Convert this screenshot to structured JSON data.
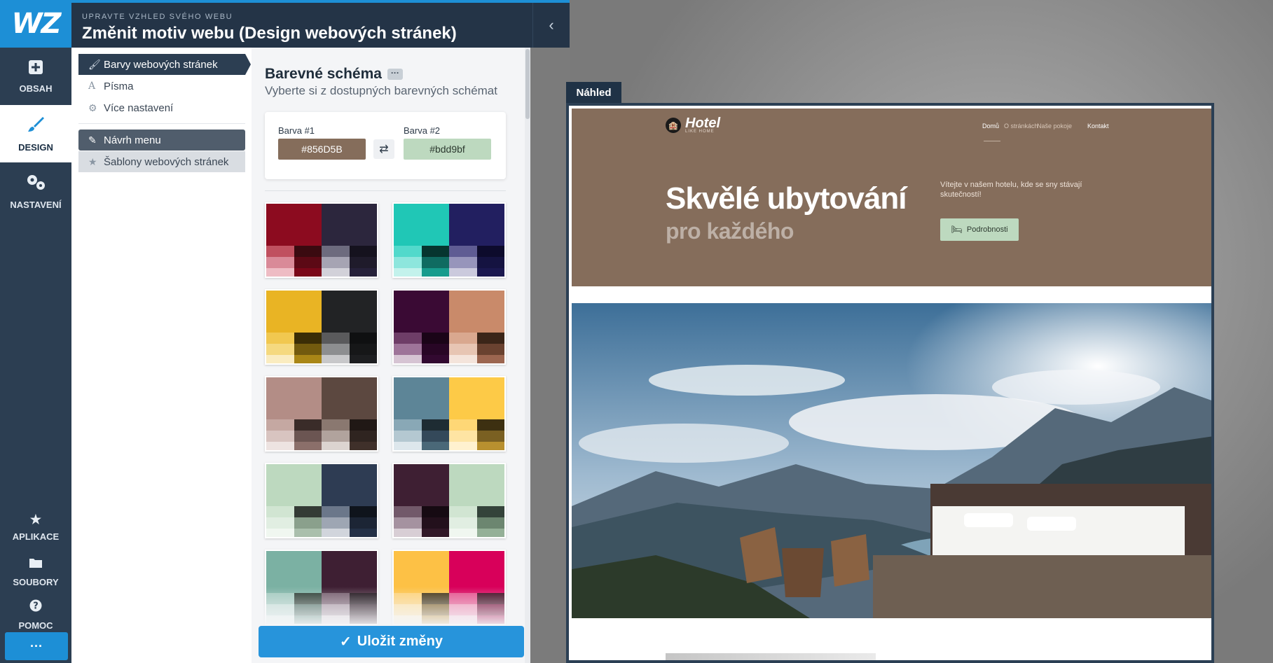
{
  "brand": {
    "logo_text": "WZ"
  },
  "header": {
    "subtitle": "UPRAVTE VZHLED SVÉHO WEBU",
    "title": "Změnit motiv webu (Design webových stránek)",
    "collapse_glyph": "‹"
  },
  "rail": {
    "items": [
      {
        "label": "OBSAH",
        "icon": "plus-square-icon"
      },
      {
        "label": "DESIGN",
        "icon": "paintbrush-icon",
        "active": true
      },
      {
        "label": "NASTAVENÍ",
        "icon": "gears-icon"
      },
      {
        "label": "APLIKACE",
        "icon": "star-icon"
      },
      {
        "label": "SOUBORY",
        "icon": "folder-icon"
      },
      {
        "label": "POMOC",
        "icon": "help-icon"
      }
    ],
    "more": "···"
  },
  "submenu": {
    "items": [
      {
        "label": "Barvy webových stránek",
        "icon": "paintbrush-icon"
      },
      {
        "label": "Písma",
        "icon": "font-icon"
      },
      {
        "label": "Více nastavení",
        "icon": "gears-icon"
      },
      {
        "label": "Návrh menu",
        "icon": "pencil-icon"
      },
      {
        "label": "Šablony webových stránek",
        "icon": "star-icon"
      }
    ]
  },
  "panel": {
    "title": "Barevné schéma",
    "dots": "···",
    "subtitle": "Vyberte si z dostupných barevných schémat",
    "color1_label": "Barva #1",
    "color1_value": "#856D5B",
    "color2_label": "Barva #2",
    "color2_value": "#bdd9bf",
    "swap_glyph": "⇄",
    "save_label": "Uložit změny",
    "palettes": [
      {
        "a": "#8c0b1f",
        "b": "#2c263d",
        "sa": [
          "#c0505f",
          "#3a0a10",
          "#d98a98",
          "#5c0915",
          "#eebcc4",
          "#7a0718"
        ],
        "sb": [
          "#6d6b7e",
          "#15121e",
          "#a6a4b3",
          "#1f1b2b",
          "#d2d1d9",
          "#26213a"
        ]
      },
      {
        "a": "#20c7b6",
        "b": "#221f60",
        "sa": [
          "#52d9cb",
          "#06352f",
          "#8ee6dd",
          "#0f6b61",
          "#c3f2ec",
          "#179c8d"
        ],
        "sb": [
          "#5f5c93",
          "#0d0b2c",
          "#9795bb",
          "#151341",
          "#cbcadd",
          "#1b184f"
        ]
      },
      {
        "a": "#e9b424",
        "b": "#222325",
        "sa": [
          "#f1c850",
          "#3a2d06",
          "#f5d97f",
          "#725a0e",
          "#faecc0",
          "#a98616"
        ],
        "sb": [
          "#5a5a5c",
          "#0f1011",
          "#8d8e90",
          "#161718",
          "#c8c8ca",
          "#1d1e20"
        ]
      },
      {
        "a": "#3a0a34",
        "b": "#c98a6a",
        "sa": [
          "#6e3d67",
          "#1a0417",
          "#9e7499",
          "#280625",
          "#d6c4d3",
          "#320930"
        ],
        "sb": [
          "#d9a88f",
          "#3b2518",
          "#e7c5b3",
          "#6a4230",
          "#f4e4db",
          "#9c6650"
        ]
      },
      {
        "a": "#b38d86",
        "b": "#5c4840",
        "sa": [
          "#c5a8a2",
          "#3a2c29",
          "#d8c4c0",
          "#6b5552",
          "#ede3e1",
          "#8b6f6a"
        ],
        "sb": [
          "#8a7870",
          "#201815",
          "#b1a39d",
          "#2f2420",
          "#dcd4d0",
          "#3f302a"
        ]
      },
      {
        "a": "#5d8597",
        "b": "#fdca47",
        "sa": [
          "#89a8b6",
          "#1e2c33",
          "#b4c8d1",
          "#34495a",
          "#dde7ec",
          "#4a6878"
        ],
        "sb": [
          "#fed776",
          "#3d3011",
          "#fee4a3",
          "#7a6022",
          "#fff1cf",
          "#b8902f"
        ]
      },
      {
        "a": "#bdd9bf",
        "b": "#2e3c53",
        "sa": [
          "#d1e5d2",
          "#343b35",
          "#e1eee2",
          "#8aa08c",
          "#f0f7f0",
          "#aabfac"
        ],
        "sb": [
          "#6b778a",
          "#0f141c",
          "#9ea6b3",
          "#1c2535",
          "#d1d5dc",
          "#243046"
        ]
      },
      {
        "a": "#3e1f33",
        "b": "#bdd9bf",
        "sa": [
          "#72596a",
          "#160a12",
          "#a592a0",
          "#23101c",
          "#d8ced5",
          "#311827"
        ],
        "sb": [
          "#d1e5d2",
          "#34433a",
          "#e1eee2",
          "#6c8670",
          "#f0f7f0",
          "#94b097"
        ]
      },
      {
        "a": "#7bb1a3",
        "b": "#3e1f33",
        "sa": [
          "#a0c8bd",
          "#26382f",
          "#c2dcd5",
          "#4b6c62",
          "#e2efeb",
          "#5e8b7e"
        ],
        "sb": [
          "#72596a",
          "#160a12",
          "#a592a0",
          "#23101c",
          "#d8ced5",
          "#311827"
        ]
      },
      {
        "a": "#fdc145",
        "b": "#d8005a",
        "sa": [
          "#fed176",
          "#3d2e10",
          "#fee1a3",
          "#7a5b1f",
          "#fff0d1",
          "#b98a2e"
        ],
        "sb": [
          "#e44d8a",
          "#3a0018",
          "#ee8cb3",
          "#70002f",
          "#f7c6da",
          "#a30045"
        ]
      }
    ]
  },
  "preview": {
    "tab_label": "Náhled",
    "site": {
      "logo_mark": "🏨",
      "logo_name": "Hotel",
      "logo_tag": "LIKE HOME",
      "nav": [
        "Domů",
        "O stránkách",
        "Naše pokoje",
        "Kontakt"
      ],
      "headline": "Skvělé ubytování",
      "subheadline": "pro každého",
      "intro": "Vítejte v našem hotelu, kde se sny stávají skutečností!",
      "button": "Podrobnosti",
      "primary_color": "#856D5B",
      "secondary_color": "#bdd9bf"
    }
  }
}
